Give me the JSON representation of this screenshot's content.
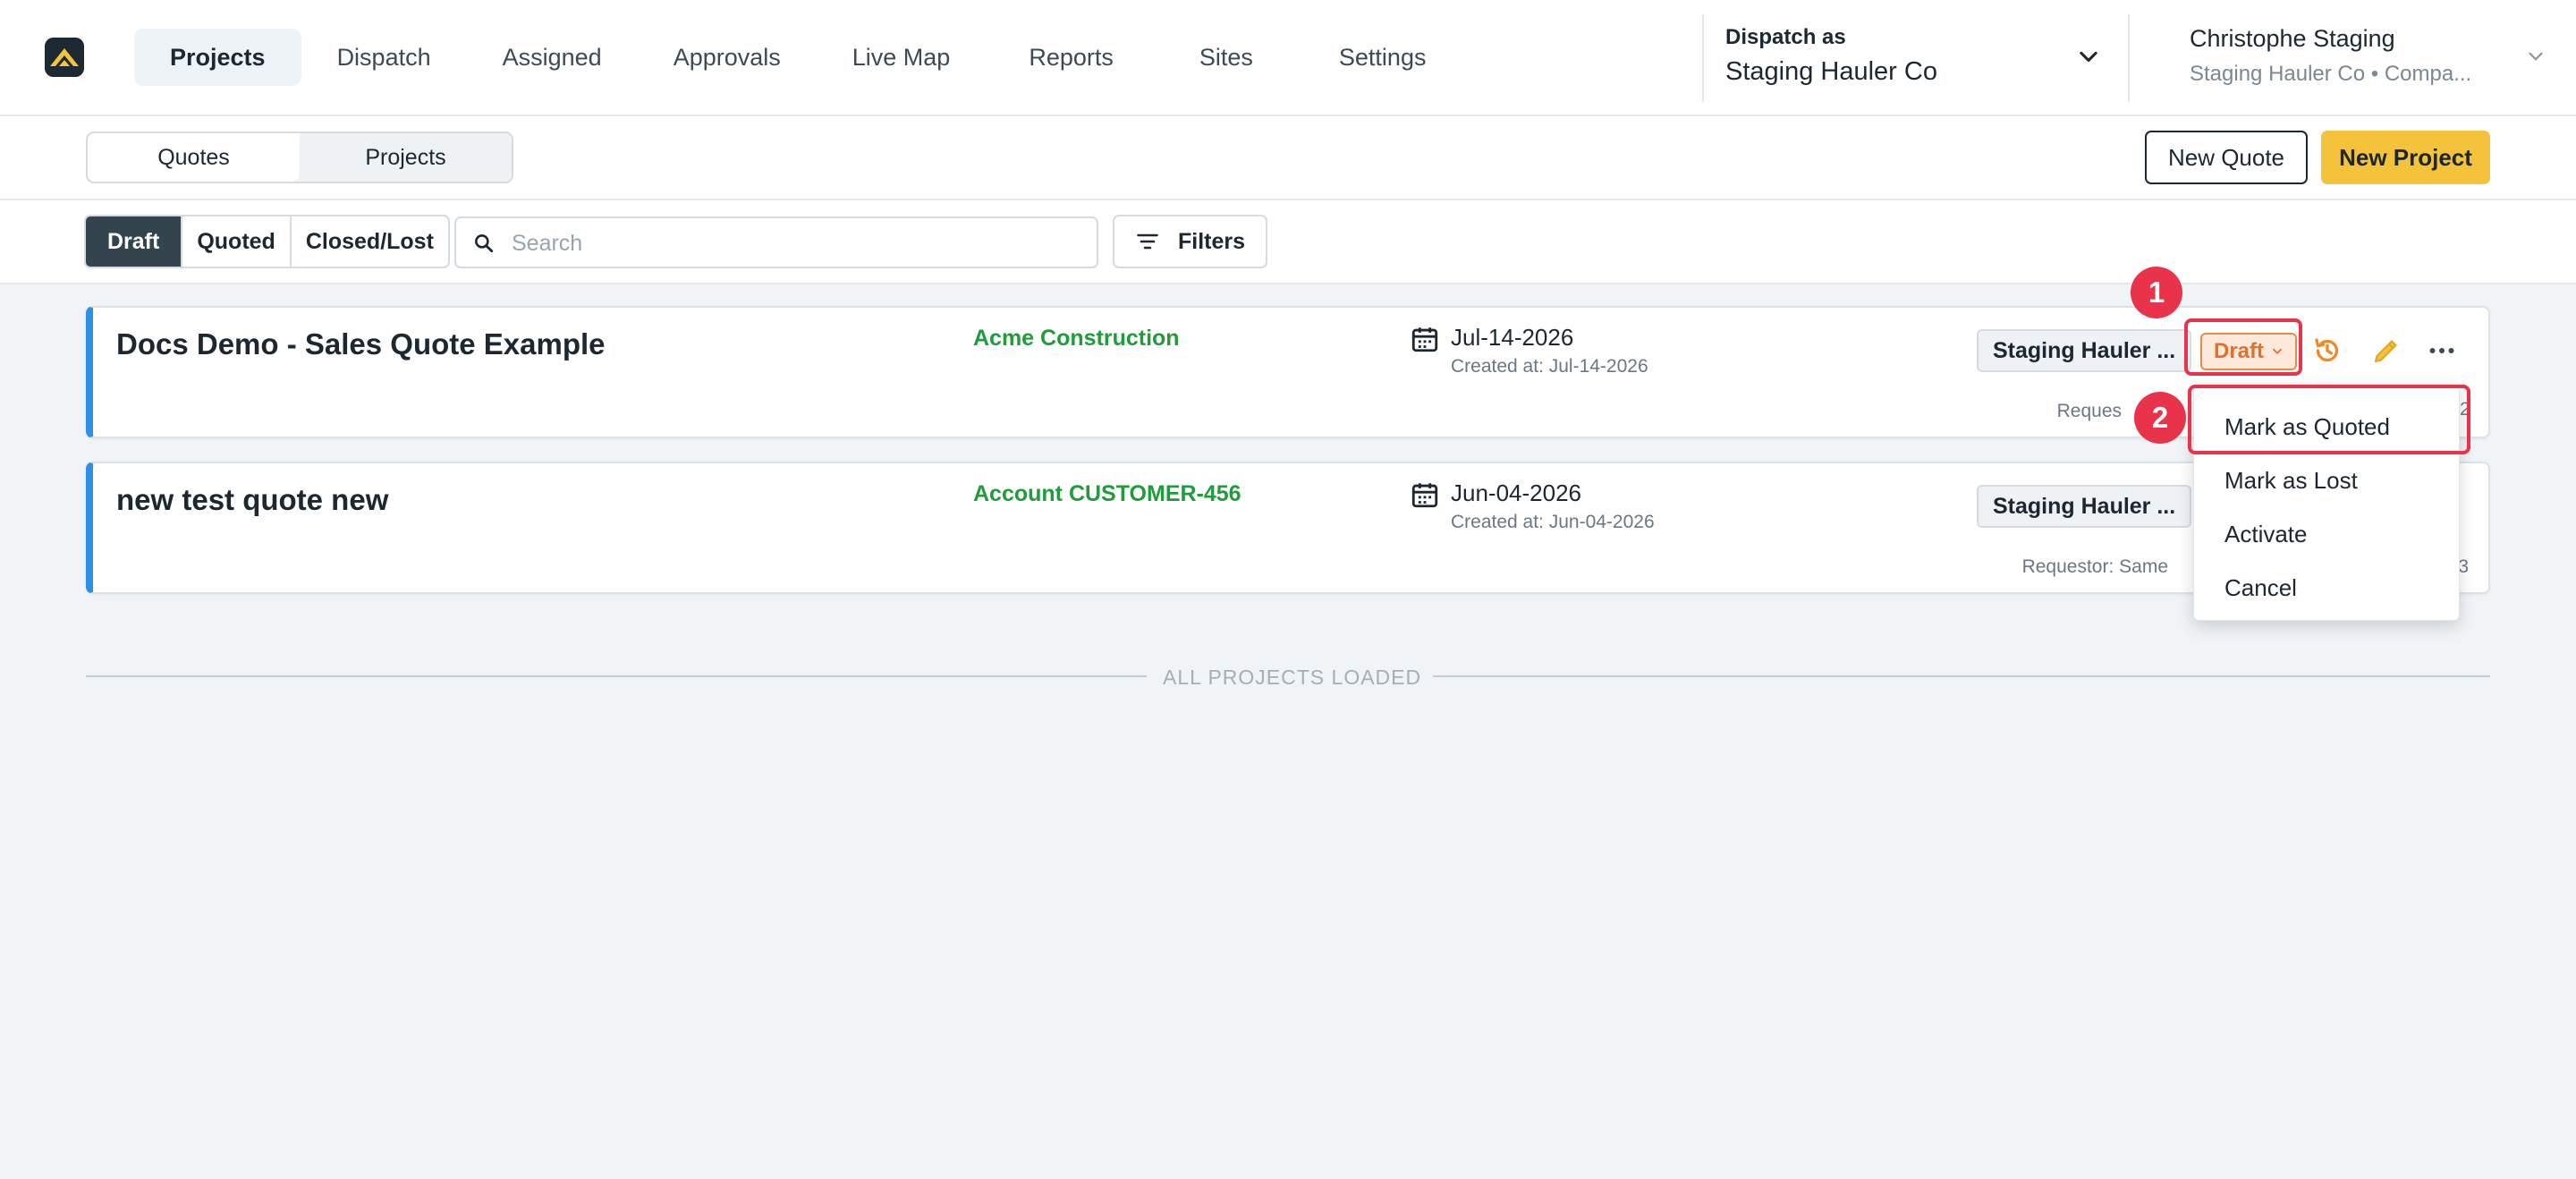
{
  "nav": {
    "items": [
      {
        "label": "Projects",
        "active": true
      },
      {
        "label": "Dispatch"
      },
      {
        "label": "Assigned"
      },
      {
        "label": "Approvals"
      },
      {
        "label": "Live Map"
      },
      {
        "label": "Reports"
      },
      {
        "label": "Sites"
      },
      {
        "label": "Settings"
      }
    ]
  },
  "dispatch": {
    "label": "Dispatch as",
    "value": "Staging Hauler Co"
  },
  "user": {
    "name": "Christophe Staging",
    "org": "Staging Hauler Co • Compa..."
  },
  "view_toggle": {
    "quotes": "Quotes",
    "projects": "Projects"
  },
  "actions": {
    "new_quote": "New Quote",
    "new_project": "New Project"
  },
  "status_tabs": {
    "draft": "Draft",
    "quoted": "Quoted",
    "closed": "Closed/Lost"
  },
  "search": {
    "placeholder": "Search",
    "value": ""
  },
  "filters": {
    "label": "Filters"
  },
  "cards": [
    {
      "title": "Docs Demo - Sales Quote Example",
      "customer": "Acme Construction",
      "date": "Jul-14-2026",
      "created": "Created at: Jul-14-2026",
      "hauler": "Staging Hauler ...",
      "status": "Draft",
      "requestor": "Reques"
    },
    {
      "title": "new test quote new",
      "customer": "Account CUSTOMER-456",
      "date": "Jun-04-2026",
      "created": "Created at: Jun-04-2026",
      "hauler": "Staging Hauler ...",
      "requestor": "Requestor: Same"
    }
  ],
  "menu": {
    "items": [
      "Mark as Quoted",
      "Mark as Lost",
      "Activate",
      "Cancel"
    ]
  },
  "annotations": {
    "one": "1",
    "two": "2"
  },
  "footer": {
    "loaded": "ALL PROJECTS LOADED"
  },
  "colors": {
    "accent": "#f4c33b",
    "draft": "#e0702e",
    "customer": "#1f9d3a",
    "annotation": "#e8334a",
    "card_border": "#2f8fe8"
  }
}
